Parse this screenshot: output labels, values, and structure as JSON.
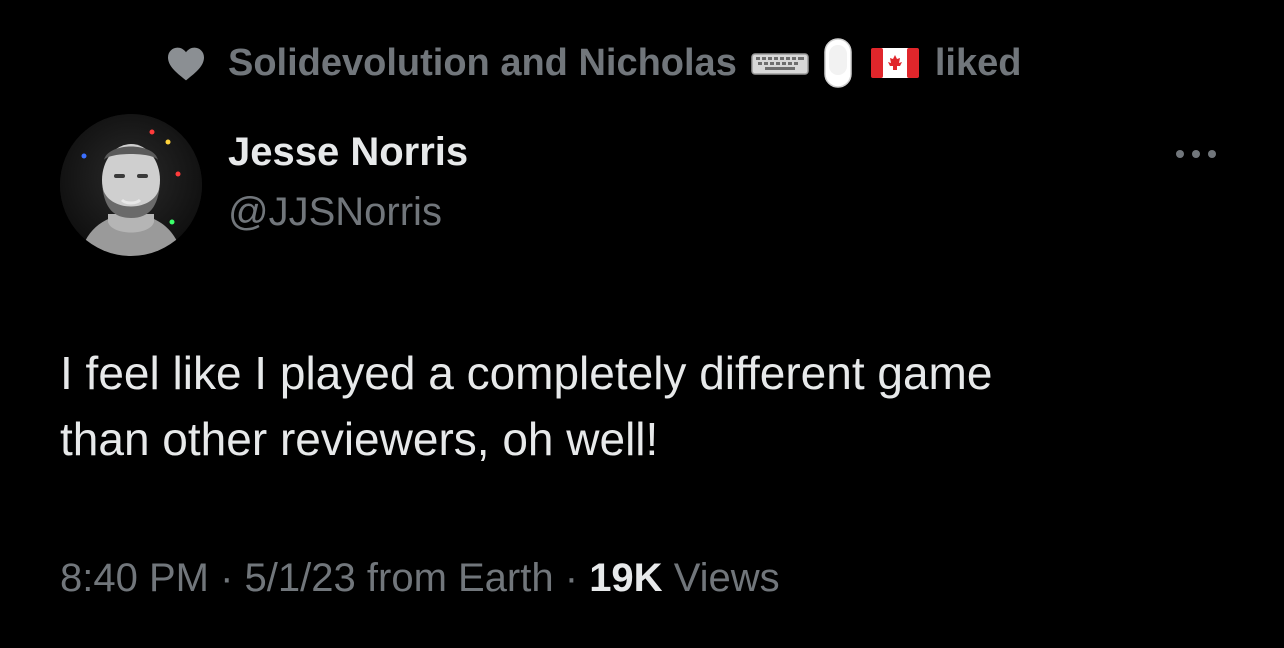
{
  "social_context": {
    "icon": "heart-icon",
    "names": "Solidevolution and Nicholas",
    "emojis": [
      "keyboard-emoji",
      "mouse-emoji",
      "canada-flag-emoji"
    ],
    "action": "liked"
  },
  "author": {
    "display_name": "Jesse Norris",
    "handle": "@JJSNorris"
  },
  "tweet": {
    "text_line_1": "I feel like I played a completely different game",
    "text_line_2": "than other reviewers, oh well!"
  },
  "meta": {
    "time": "8:40 PM",
    "date": "5/1/23",
    "source": "from Earth",
    "separator": "·",
    "views_count": "19K",
    "views_label": "Views"
  },
  "colors": {
    "background": "#000000",
    "primary_text": "#e7e9ea",
    "secondary_text": "#71767b"
  }
}
